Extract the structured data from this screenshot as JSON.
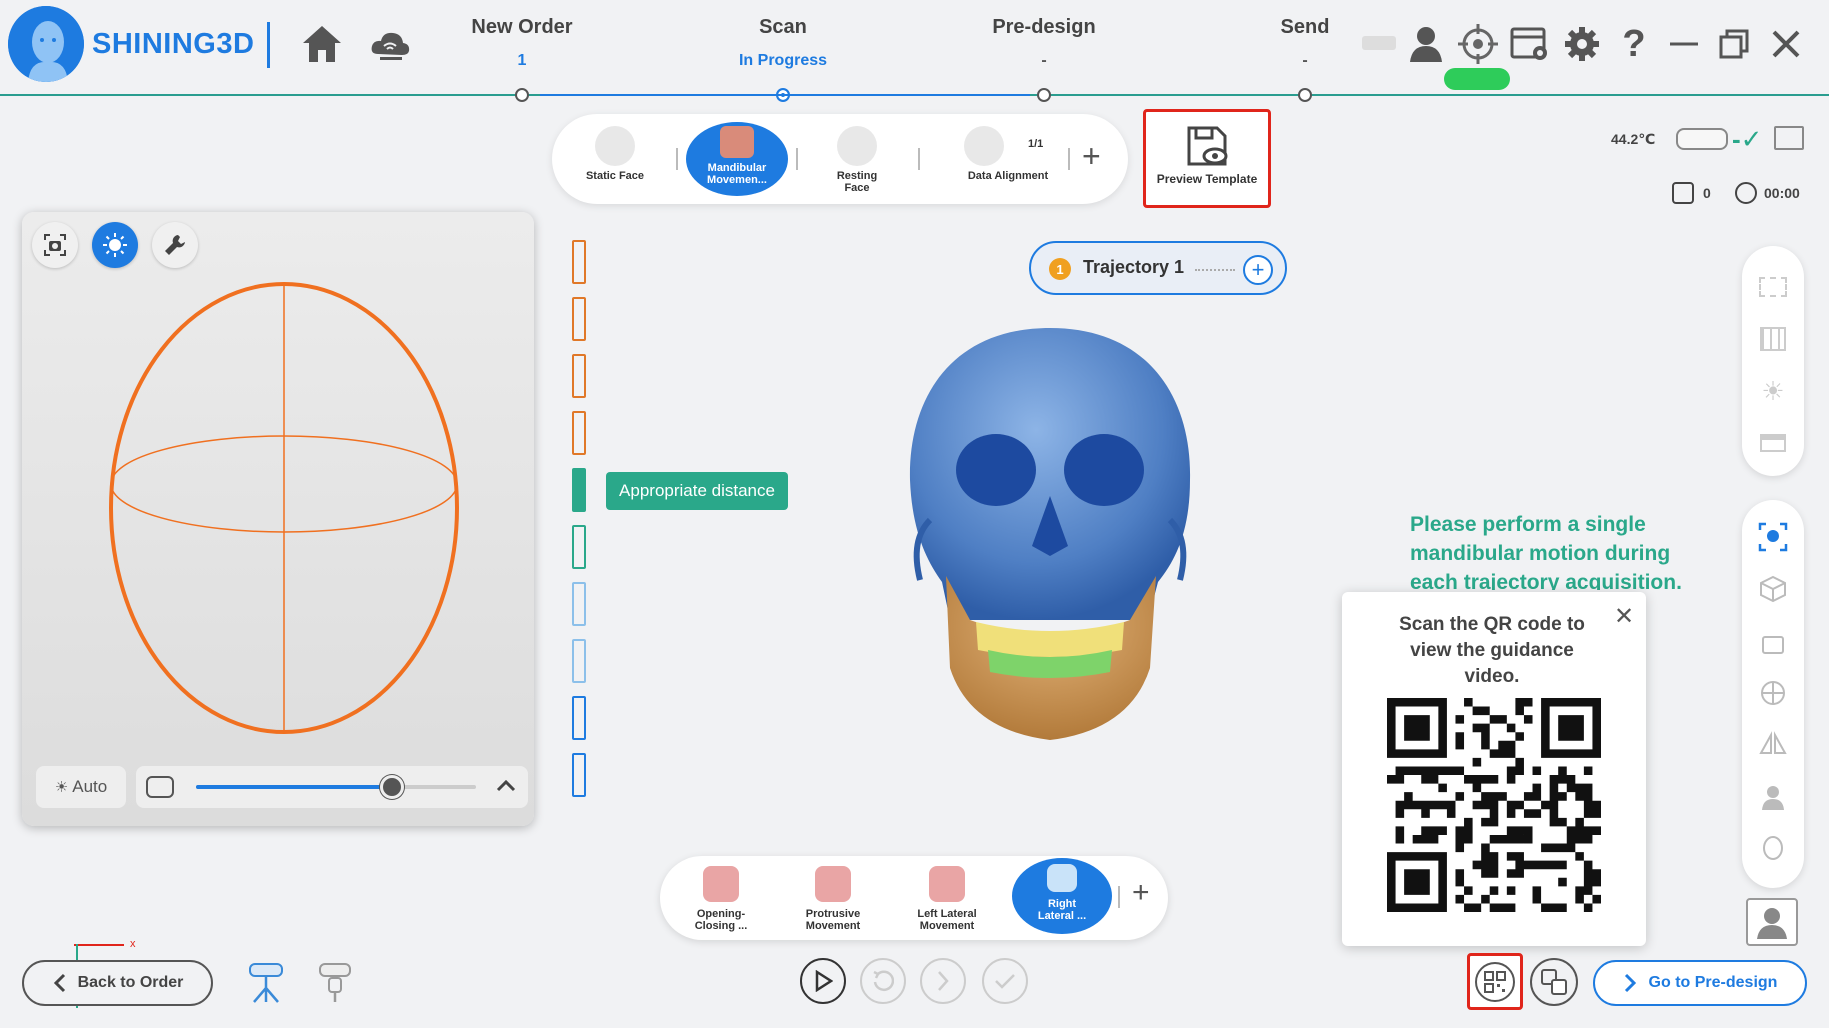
{
  "app": {
    "brand": "SHINING3D",
    "accent_color": "#1e7be0",
    "alert_color": "#e0251b",
    "success_color": "#2aa88a"
  },
  "header": {
    "steps": [
      {
        "name": "New Order",
        "status": "1"
      },
      {
        "name": "Scan",
        "status": "In Progress"
      },
      {
        "name": "Pre-design",
        "status": "-"
      },
      {
        "name": "Send",
        "status": "-"
      }
    ],
    "icons": [
      "home-icon",
      "cloud-wifi-icon",
      "user-icon",
      "crosshair-icon",
      "image-settings-icon",
      "gear-icon",
      "help-icon",
      "minimize-icon",
      "restore-icon",
      "close-icon"
    ]
  },
  "modes": {
    "items": [
      {
        "label": "Static Face"
      },
      {
        "label": "Mandibular Movemen..."
      },
      {
        "label": "Resting Face"
      },
      {
        "label": "Data Alignment",
        "count": "1/1"
      }
    ],
    "add_label": "+",
    "preview_template": "Preview Template"
  },
  "status": {
    "temperature": "44.2℃",
    "frame_count": "0",
    "timer": "00:00"
  },
  "camera": {
    "auto_label": "Auto",
    "exposure_level": 0.7
  },
  "distance": {
    "tip": "Appropriate distance"
  },
  "trajectory": {
    "number": "1",
    "label": "Trajectory 1",
    "add_label": "+"
  },
  "instruction": "Please perform a single mandibular motion during each trajectory acquisition.",
  "qr_popup": {
    "text": "Scan the QR code to view the guidance video.",
    "close": "✕"
  },
  "motions": {
    "items": [
      {
        "label": "Opening-Closing ..."
      },
      {
        "label": "Protrusive Movement"
      },
      {
        "label": "Left Lateral Movement"
      },
      {
        "label": "Right Lateral ..."
      }
    ],
    "add_label": "+"
  },
  "footer": {
    "back": "Back to Order",
    "next": "Go to Pre-design"
  }
}
